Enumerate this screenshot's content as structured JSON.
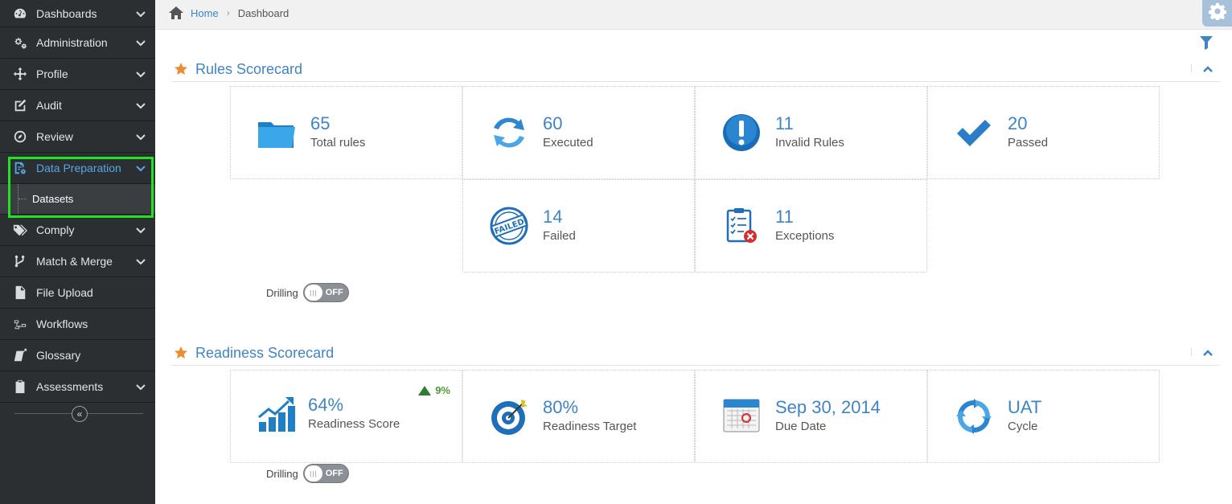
{
  "sidebar": {
    "items": [
      {
        "label": "Dashboards",
        "icon": "dashboard-icon"
      },
      {
        "label": "Administration",
        "icon": "cogs-icon"
      },
      {
        "label": "Profile",
        "icon": "profile-icon"
      },
      {
        "label": "Audit",
        "icon": "edit-icon"
      },
      {
        "label": "Review",
        "icon": "compass-icon"
      },
      {
        "label": "Data Preparation",
        "icon": "data-prep-icon"
      },
      {
        "label": "Comply",
        "icon": "tags-icon"
      },
      {
        "label": "Match & Merge",
        "icon": "merge-icon"
      },
      {
        "label": "File Upload",
        "icon": "file-icon"
      },
      {
        "label": "Workflows",
        "icon": "workflow-icon"
      },
      {
        "label": "Glossary",
        "icon": "glossary-icon"
      },
      {
        "label": "Assessments",
        "icon": "clipboard-icon"
      }
    ],
    "subitem": {
      "label": "Datasets"
    },
    "collapse_glyph": "«"
  },
  "breadcrumb": {
    "home": "Home",
    "separator": "›",
    "current": "Dashboard"
  },
  "rules": {
    "title": "Rules Scorecard",
    "tiles": [
      {
        "value": "65",
        "label": "Total rules",
        "icon": "folder-icon"
      },
      {
        "value": "60",
        "label": "Executed",
        "icon": "refresh-icon"
      },
      {
        "value": "11",
        "label": "Invalid Rules",
        "icon": "exclamation-icon"
      },
      {
        "value": "20",
        "label": "Passed",
        "icon": "checkmark-icon"
      },
      {
        "value": "14",
        "label": "Failed",
        "icon": "failed-stamp-icon"
      },
      {
        "value": "11",
        "label": "Exceptions",
        "icon": "checklist-error-icon"
      }
    ],
    "drilling": {
      "label": "Drilling",
      "state": "OFF"
    }
  },
  "readiness": {
    "title": "Readiness Scorecard",
    "tiles": [
      {
        "value": "64%",
        "label": "Readiness Score",
        "delta": "9%",
        "icon": "growth-chart-icon"
      },
      {
        "value": "80%",
        "label": "Readiness Target",
        "icon": "target-icon"
      },
      {
        "value": "Sep 30, 2014",
        "label": "Due Date",
        "icon": "calendar-icon"
      },
      {
        "value": "UAT",
        "label": "Cycle",
        "icon": "cycle-icon"
      }
    ],
    "drilling": {
      "label": "Drilling",
      "state": "OFF"
    }
  },
  "colors": {
    "accent": "#3f84c4",
    "star": "#f08a33",
    "highlight": "#22e322",
    "sidebar": "#2b2f31"
  }
}
